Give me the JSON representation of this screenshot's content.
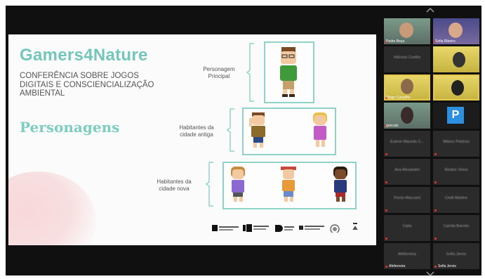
{
  "slide": {
    "brand": "Gamers4Nature",
    "conference": "CONFERÊNCIA SOBRE JOGOS DIGITAIS E CONSCIENCIALIZAÇÃO AMBIENTAL",
    "section": "Personagens",
    "groups": [
      {
        "label": "Personagem Principal"
      },
      {
        "label": "Habitantes da cidade antiga"
      },
      {
        "label": "Habitantes da cidade nova"
      }
    ]
  },
  "participants": [
    {
      "name": "Pedro Beça",
      "display": "",
      "highlighted": false
    },
    {
      "name": "Sofia Ribeiro",
      "display": "",
      "highlighted": false
    },
    {
      "name": "",
      "display": "Hélcinio Coelho",
      "highlighted": false
    },
    {
      "name": "",
      "display": "",
      "highlighted": false
    },
    {
      "name": "Diogo Carvalho",
      "display": "",
      "highlighted": true
    },
    {
      "name": "",
      "display": "",
      "highlighted": true
    },
    {
      "name": "goncalo",
      "display": "",
      "highlighted": false
    },
    {
      "name": "",
      "display": "",
      "highlighted": false
    },
    {
      "name": "",
      "display": "Eulene Macedo C...",
      "highlighted": false
    },
    {
      "name": "",
      "display": "Mitano Pekinso",
      "highlighted": false
    },
    {
      "name": "",
      "display": "Ana Alexandre",
      "highlighted": false
    },
    {
      "name": "",
      "display": "Beatriz Vieira",
      "highlighted": false
    },
    {
      "name": "",
      "display": "Fionis Macuard",
      "highlighted": false
    },
    {
      "name": "",
      "display": "Cedil Martins",
      "highlighted": false
    },
    {
      "name": "",
      "display": "Catia",
      "highlighted": false
    },
    {
      "name": "",
      "display": "Camila Barreto",
      "highlighted": false
    },
    {
      "name": "Afeferreira",
      "display": "Afeferreira",
      "highlighted": false
    },
    {
      "name": "Sofia Jervis",
      "display": "Sofia Jervis",
      "highlighted": false
    }
  ],
  "icons": {
    "scroll_up": "chevron-up-icon",
    "scroll_down": "chevron-down-icon",
    "presenter": "p-icon"
  },
  "colors": {
    "accent": "#73c6b9",
    "highlight": "#e6c84a"
  }
}
